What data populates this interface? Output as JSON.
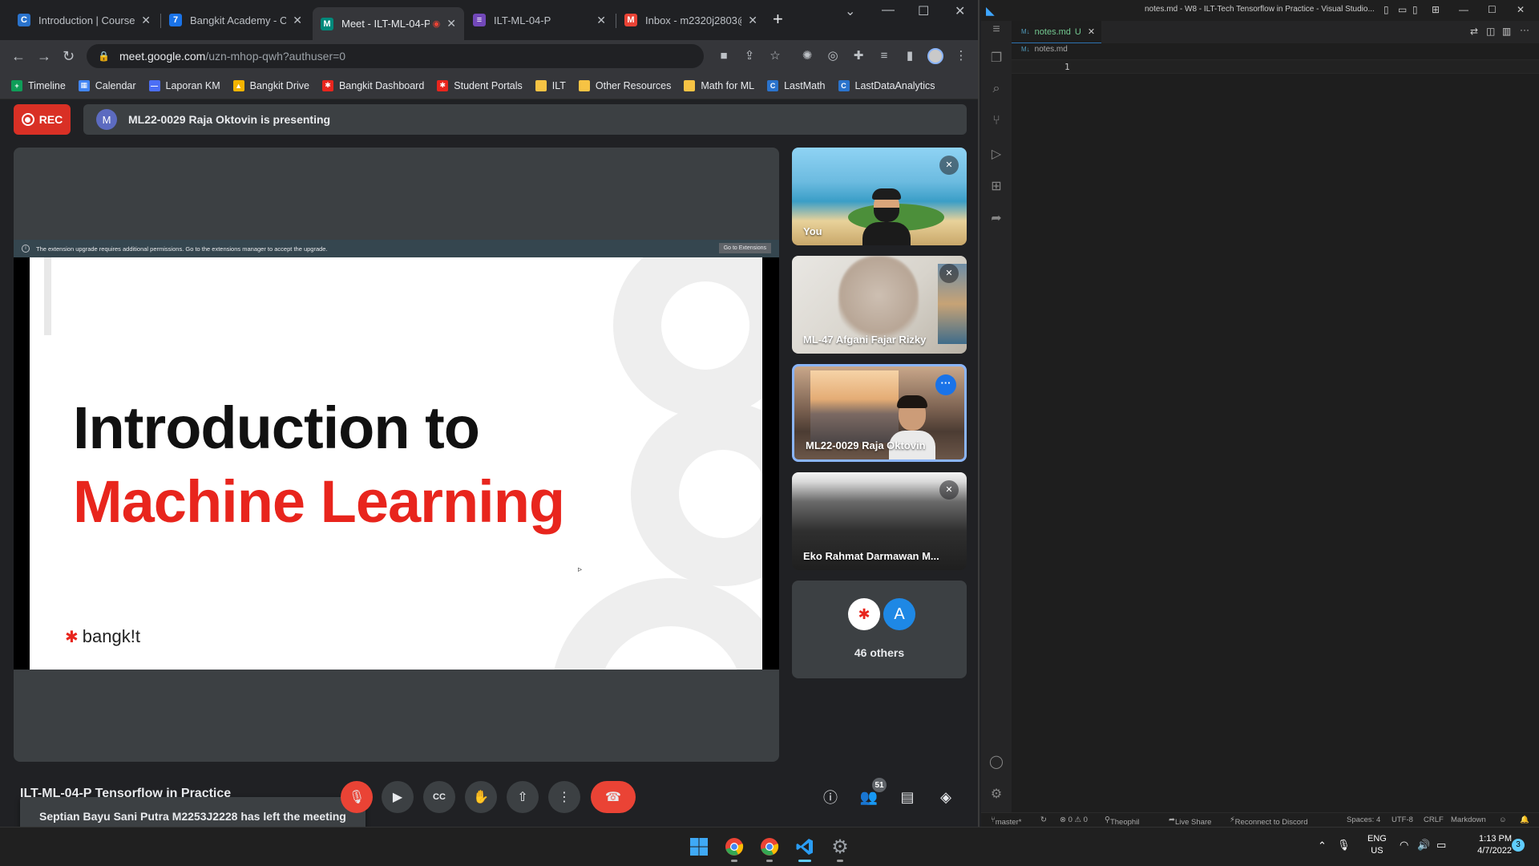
{
  "browser": {
    "tabs": [
      {
        "title": "Introduction | Coursera",
        "icon": "coursera-icon",
        "color": "#2a73cc",
        "glyph": "C"
      },
      {
        "title": "Bangkit Academy - Cale",
        "icon": "calendar-icon",
        "color": "#1a73e8",
        "glyph": "7"
      },
      {
        "title": "Meet - ILT-ML-04-P",
        "icon": "meet-icon",
        "color": "#00897b",
        "glyph": "M"
      },
      {
        "title": "ILT-ML-04-P",
        "icon": "form-icon",
        "color": "#7248b9",
        "glyph": "≡"
      },
      {
        "title": "Inbox - m2320j2803@",
        "icon": "gmail-icon",
        "color": "#ea4335",
        "glyph": "M"
      }
    ],
    "url_host": "meet.google.com",
    "url_path": "/uzn-mhop-qwh?authuser=0",
    "bookmarks": [
      {
        "label": "Timeline",
        "icon": "sheets-icon",
        "color": "#0f9d58",
        "glyph": "+"
      },
      {
        "label": "Calendar",
        "icon": "calendar-icon",
        "color": "#4285f4",
        "glyph": "▦"
      },
      {
        "label": "Laporan KM",
        "icon": "doc-icon",
        "color": "#4c6ef5",
        "glyph": "—"
      },
      {
        "label": "Bangkit Drive",
        "icon": "drive-icon",
        "color": "#f4b400",
        "glyph": "▲"
      },
      {
        "label": "Bangkit Dashboard",
        "icon": "bangkit-icon",
        "color": "#e8251d",
        "glyph": "✱"
      },
      {
        "label": "Student Portals",
        "icon": "bangkit-icon",
        "color": "#e8251d",
        "glyph": "✱"
      },
      {
        "label": "ILT",
        "icon": "folder-icon",
        "color": "#f6c344",
        "glyph": ""
      },
      {
        "label": "Other Resources",
        "icon": "folder-icon",
        "color": "#f6c344",
        "glyph": ""
      },
      {
        "label": "Math for ML",
        "icon": "folder-icon",
        "color": "#f6c344",
        "glyph": ""
      },
      {
        "label": "LastMath",
        "icon": "coursera-icon",
        "color": "#2a73cc",
        "glyph": "C"
      },
      {
        "label": "LastDataAnalytics",
        "icon": "coursera-icon",
        "color": "#2a73cc",
        "glyph": "C"
      }
    ]
  },
  "meet": {
    "rec_label": "REC",
    "presenter_initial": "M",
    "presenting_text": "ML22-0029 Raja Oktovin is presenting",
    "extension_notice": "The extension upgrade requires additional permissions. Go to the extensions manager to accept the upgrade.",
    "extension_button": "Go to Extensions",
    "slide_line1": "Introduction to",
    "slide_line2": "Machine Learning",
    "slide_logo": "bangk!t",
    "toast": "Septian Bayu Sani Putra M2253J2228 has left the meeting",
    "participants": [
      {
        "name": "You"
      },
      {
        "name": "ML-47 Afgani Fajar Rizky"
      },
      {
        "name": "ML22-0029 Raja Oktovin"
      },
      {
        "name": "Eko Rahmat Darmawan M..."
      }
    ],
    "others_avatar": "A",
    "others_label": "46 others",
    "meeting_title": "ILT-ML-04-P Tensorflow in Practice",
    "people_count": "51"
  },
  "vscode": {
    "window_title": "notes.md - W8 - ILT-Tech Tensorflow in Practice - Visual Studio...",
    "tab_label": "notes.md",
    "tab_status": "U",
    "breadcrumb": "notes.md",
    "line_number": "1",
    "status": {
      "branch": "master*",
      "problems": "⊗ 0 ⚠ 0",
      "user": "Theophil",
      "live_share": "Live Share",
      "discord": "Reconnect to Discord",
      "spaces": "Spaces: 4",
      "encoding": "UTF-8",
      "eol": "CRLF",
      "language": "Markdown"
    }
  },
  "taskbar": {
    "lang_top": "ENG",
    "lang_bottom": "US",
    "time": "1:13 PM",
    "date": "4/7/2022",
    "notifications": "3"
  }
}
